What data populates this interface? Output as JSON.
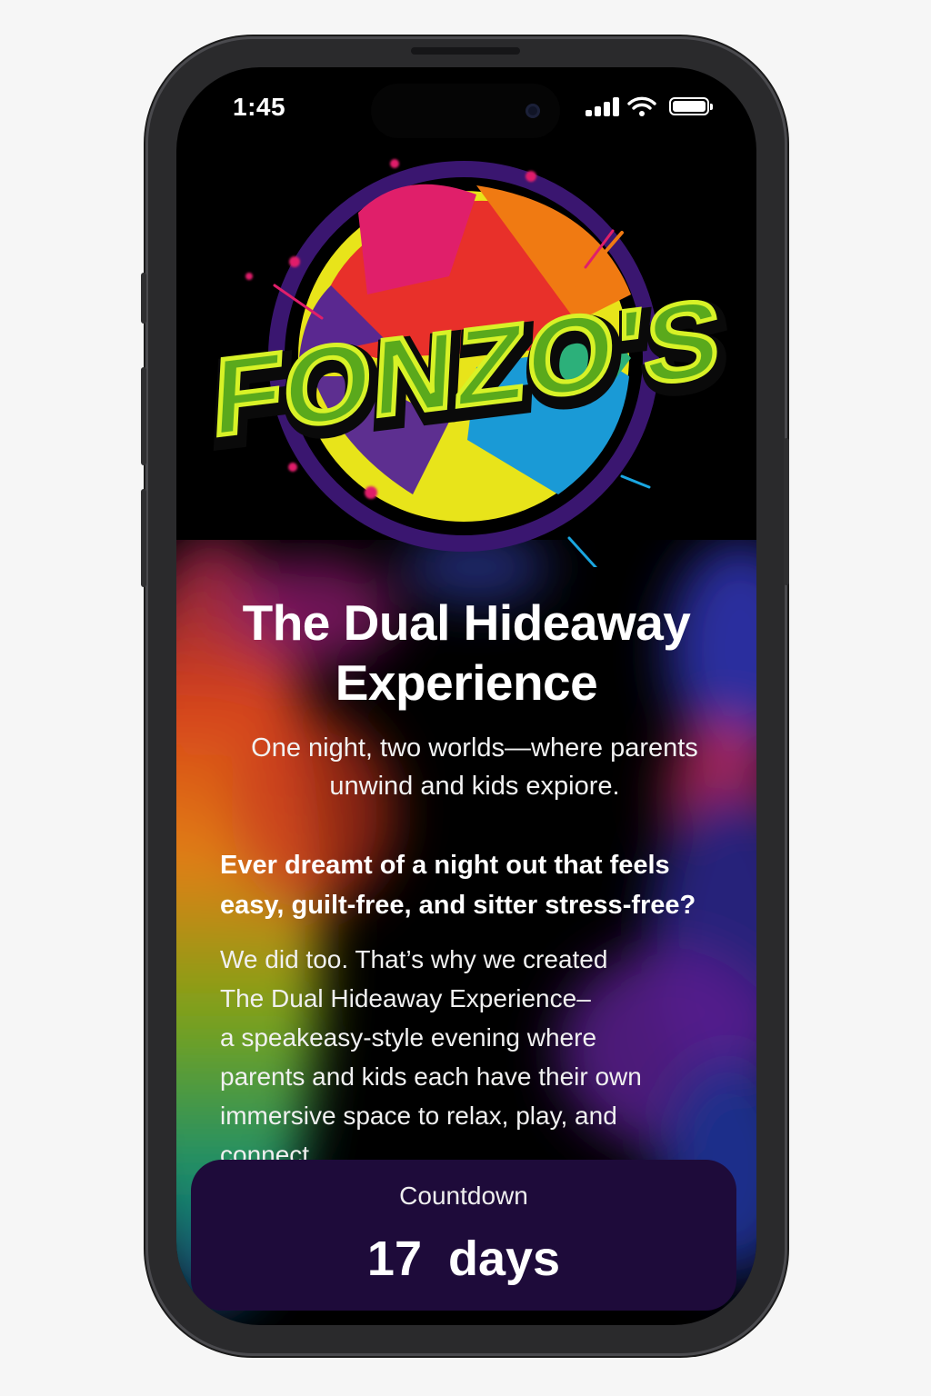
{
  "status_bar": {
    "time": "1:45"
  },
  "logo": {
    "text": "FONZO'S"
  },
  "hero": {
    "title_line1": "The Dual Hideaway",
    "title_line2": "Experience",
    "subtitle_line1": "One night, two worlds—where parents",
    "subtitle_line2": "unwind and kids expiore."
  },
  "intro": {
    "question_line1": "Ever dreamt of a night out that feels",
    "question_line2": "easy, guilt-free, and sitter stress-free?",
    "body_lines": [
      "We did too. That’s why we created",
      "The Dual Hideaway Experience–",
      "a speakeasy-style evening where",
      "parents and kids each have their own",
      "immersive space to relax, play, and",
      "connect."
    ]
  },
  "countdown": {
    "label": "Countdown",
    "value": "17",
    "unit": "days"
  },
  "colors": {
    "panel": "#1e0b3a",
    "logo_green": "#5aa91c",
    "logo_outline": "#d8f227"
  }
}
